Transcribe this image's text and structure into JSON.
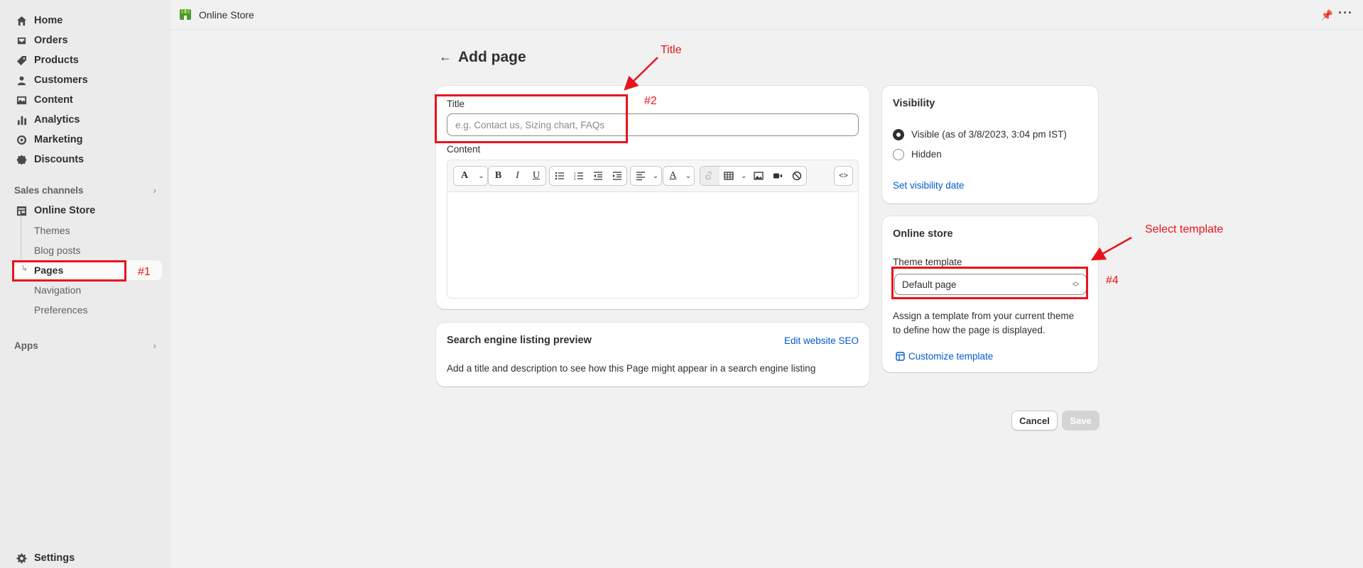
{
  "sidebar": {
    "items": [
      {
        "label": "Home",
        "icon": "home-icon"
      },
      {
        "label": "Orders",
        "icon": "inbox-icon"
      },
      {
        "label": "Products",
        "icon": "tag-icon"
      },
      {
        "label": "Customers",
        "icon": "person-icon"
      },
      {
        "label": "Content",
        "icon": "image-icon"
      },
      {
        "label": "Analytics",
        "icon": "bar-chart-icon"
      },
      {
        "label": "Marketing",
        "icon": "target-icon"
      },
      {
        "label": "Discounts",
        "icon": "discount-icon"
      }
    ],
    "sales_channels_label": "Sales channels",
    "online_store_label": "Online Store",
    "sub_items": [
      "Themes",
      "Blog posts",
      "Pages",
      "Navigation",
      "Preferences"
    ],
    "apps_label": "Apps",
    "settings_label": "Settings"
  },
  "topbar": {
    "store_name": "Online Store"
  },
  "page": {
    "back_icon": "arrow-left-icon",
    "title": "Add page"
  },
  "main_card": {
    "title_label": "Title",
    "title_placeholder": "e.g. Contact us, Sizing chart, FAQs",
    "title_value": "",
    "content_label": "Content",
    "source_button": "<>"
  },
  "seo_card": {
    "heading": "Search engine listing preview",
    "edit_link": "Edit website SEO",
    "description": "Add a title and description to see how this Page might appear in a search engine listing"
  },
  "visibility_card": {
    "heading": "Visibility",
    "options": [
      {
        "label": "Visible (as of 3/8/2023, 3:04 pm IST)",
        "checked": true
      },
      {
        "label": "Hidden",
        "checked": false
      }
    ],
    "set_date_link": "Set visibility date"
  },
  "online_store_card": {
    "heading": "Online store",
    "template_label": "Theme template",
    "template_value": "Default page",
    "help_text_line1": "Assign a template from your current theme",
    "help_text_line2": "to define how the page is displayed.",
    "customize_link": "Customize template"
  },
  "actions": {
    "cancel": "Cancel",
    "save": "Save"
  },
  "annotations": {
    "title_note": "Title",
    "step1": "#1",
    "step2": "#2",
    "step4": "#4",
    "template_note": "Select template",
    "color": "#e8141c"
  }
}
